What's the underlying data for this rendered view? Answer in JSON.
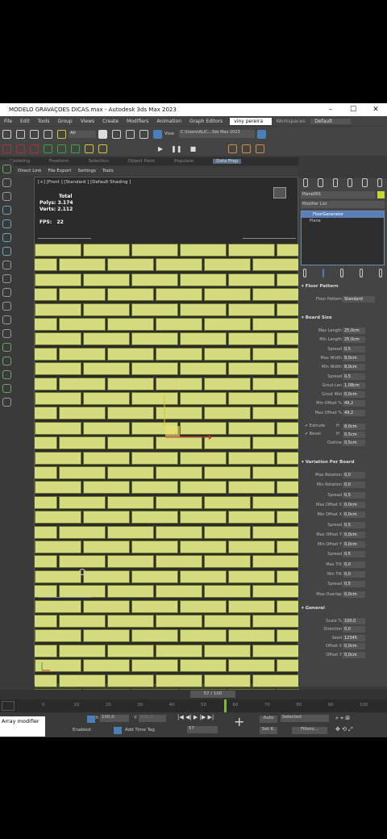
{
  "window": {
    "title": "MODELO GRAVAÇOES DICAS.max - Autodesk 3ds Max 2023"
  },
  "menu": {
    "items": [
      "File",
      "Edit",
      "Tools",
      "Group",
      "Views",
      "Create",
      "Modifiers",
      "Animation",
      "Graph Editors"
    ],
    "user": "viny pereira",
    "workspace_label": "Workspaces:",
    "workspace": "Default"
  },
  "toolbar": {
    "selection_filter": "All",
    "view": "View",
    "path": "C:\\Users\\ALIC...3ds Max 2023"
  },
  "ribbon": {
    "tabs": [
      "Modeling",
      "Freeform",
      "Selection",
      "Object Paint",
      "Populate",
      "Data Prep"
    ],
    "active": "Data Prep"
  },
  "subbar": {
    "items": [
      "Direct Link",
      "File Export",
      "Settings",
      "Tools"
    ]
  },
  "viewport": {
    "label": "[+] [Front ] [Standard ] [Default Shading ]",
    "stats": {
      "total": "Total",
      "polys_label": "Polys:",
      "polys": "3.174",
      "verts_label": "Verts:",
      "verts": "2.112",
      "fps_label": "FPS:",
      "fps": "22"
    }
  },
  "command_panel": {
    "object_name": "Plane001",
    "modifier_list": "Modifier List",
    "stack": [
      "FloorGenerator",
      "Plane"
    ],
    "floor_pattern": {
      "title": "Floor Pattern",
      "label": "Floor Pattern",
      "value": "Standard"
    },
    "board_size": {
      "title": "Board Size",
      "fields": [
        {
          "label": "Max Length",
          "value": "25,0cm"
        },
        {
          "label": "Min Length",
          "value": "25,0cm"
        },
        {
          "label": "Spread",
          "value": "0,5"
        },
        {
          "label": "Max Width",
          "value": "8,0cm"
        },
        {
          "label": "Min Width",
          "value": "8,0cm"
        },
        {
          "label": "Spread",
          "value": "0,5"
        },
        {
          "label": "Grout Len",
          "value": "1,08cm"
        },
        {
          "label": "Grout Wid",
          "value": "0,0cm"
        },
        {
          "label": "Min Offset %",
          "value": "49,2"
        },
        {
          "label": "Max Offset %",
          "value": "49,2"
        }
      ],
      "extrude": {
        "label": "Extrude",
        "h": "H",
        "value": "8,0cm"
      },
      "bevel": {
        "label": "Bevel",
        "h": "H",
        "value": "0,5cm"
      },
      "outline": {
        "label": "Outline",
        "value": "0,5cm"
      }
    },
    "variation": {
      "title": "Variation Per Board",
      "fields": [
        {
          "label": "Max Rotation",
          "value": "0,0"
        },
        {
          "label": "Min Rotation",
          "value": "0,0"
        },
        {
          "label": "Spread",
          "value": "0,5"
        },
        {
          "label": "Max Offset X",
          "value": "0,0cm"
        },
        {
          "label": "Min Offset X",
          "value": "0,0cm"
        },
        {
          "label": "Spread",
          "value": "0,5"
        },
        {
          "label": "Max Offset Y",
          "value": "0,0cm"
        },
        {
          "label": "Min Offset Y",
          "value": "0,0cm"
        },
        {
          "label": "Spread",
          "value": "0,5"
        },
        {
          "label": "Max Tilt",
          "value": "0,0"
        },
        {
          "label": "Min Tilt",
          "value": "0,0"
        },
        {
          "label": "Spread",
          "value": "0,5"
        },
        {
          "label": "Max Overlap",
          "value": "0,0cm"
        }
      ]
    },
    "general": {
      "title": "General",
      "fields": [
        {
          "label": "Scale %",
          "value": "100,0"
        },
        {
          "label": "Direction",
          "value": "0,0"
        },
        {
          "label": "Seed",
          "value": "12345"
        },
        {
          "label": "Offset X",
          "value": "0,0cm"
        },
        {
          "label": "Offset Y",
          "value": "0,0cm"
        }
      ]
    }
  },
  "timeline": {
    "frame": "57 / 100",
    "ticks": [
      "0",
      "10",
      "20",
      "30",
      "40",
      "50",
      "60",
      "70",
      "80",
      "90",
      "100"
    ]
  },
  "status": {
    "script": "Array modifier",
    "x_label": "X:",
    "x": "100,0",
    "y_label": "Y:",
    "y": "100,0",
    "enabled": "Enabled:",
    "add_time_tag": "Add Time Tag",
    "auto": "Auto",
    "selected": "Selected",
    "set_k": "Set K.",
    "filters": "Filters...",
    "frame": "57"
  },
  "colors": {
    "brick": "#d3db7e",
    "grout": "#6f742c",
    "logo": "#f2d52a"
  }
}
